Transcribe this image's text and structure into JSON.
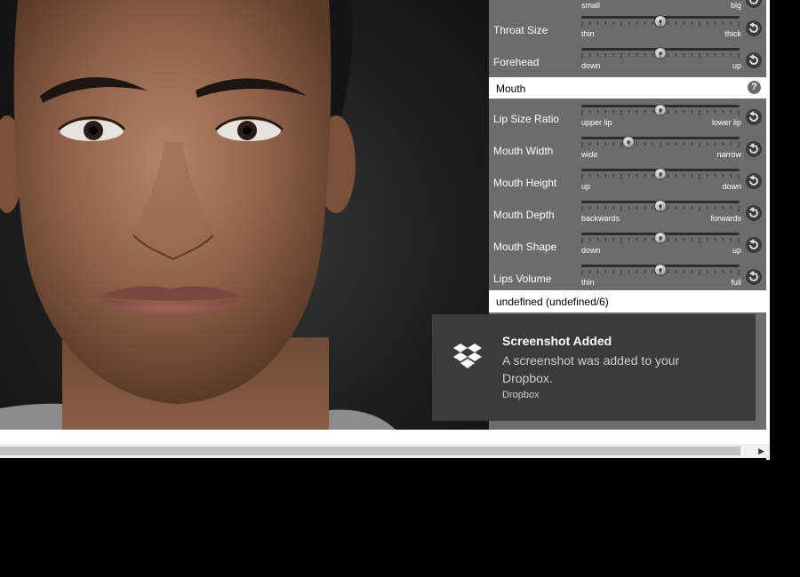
{
  "viewport": {
    "description_icon": "3d-face-model"
  },
  "sliders_top": [
    {
      "label": "",
      "min": "small",
      "max": "big",
      "value": 0.5
    },
    {
      "label": "Throat Size",
      "min": "thin",
      "max": "thick",
      "value": 0.5
    },
    {
      "label": "Forehead",
      "min": "down",
      "max": "up",
      "value": 0.5
    }
  ],
  "mouth_section": {
    "title": "Mouth",
    "help": "?",
    "sliders": [
      {
        "label": "Lip Size Ratio",
        "min": "upper lip",
        "max": "lower lip",
        "value": 0.5
      },
      {
        "label": "Mouth Width",
        "min": "wide",
        "max": "narrow",
        "value": 0.3
      },
      {
        "label": "Mouth Height",
        "min": "up",
        "max": "down",
        "value": 0.5
      },
      {
        "label": "Mouth Depth",
        "min": "backwards",
        "max": "forwards",
        "value": 0.5
      },
      {
        "label": "Mouth Shape",
        "min": "down",
        "max": "up",
        "value": 0.5
      },
      {
        "label": "Lips Volume",
        "min": "thin",
        "max": "full",
        "value": 0.5
      }
    ]
  },
  "status": "undefined (undefined/6)",
  "toast": {
    "icon": "dropbox-icon",
    "title": "Screenshot Added",
    "message": "A screenshot was added to your Dropbox.",
    "source": "Dropbox"
  },
  "colors": {
    "panel": "#6c6c6c",
    "toast": "#3b3b3b"
  }
}
